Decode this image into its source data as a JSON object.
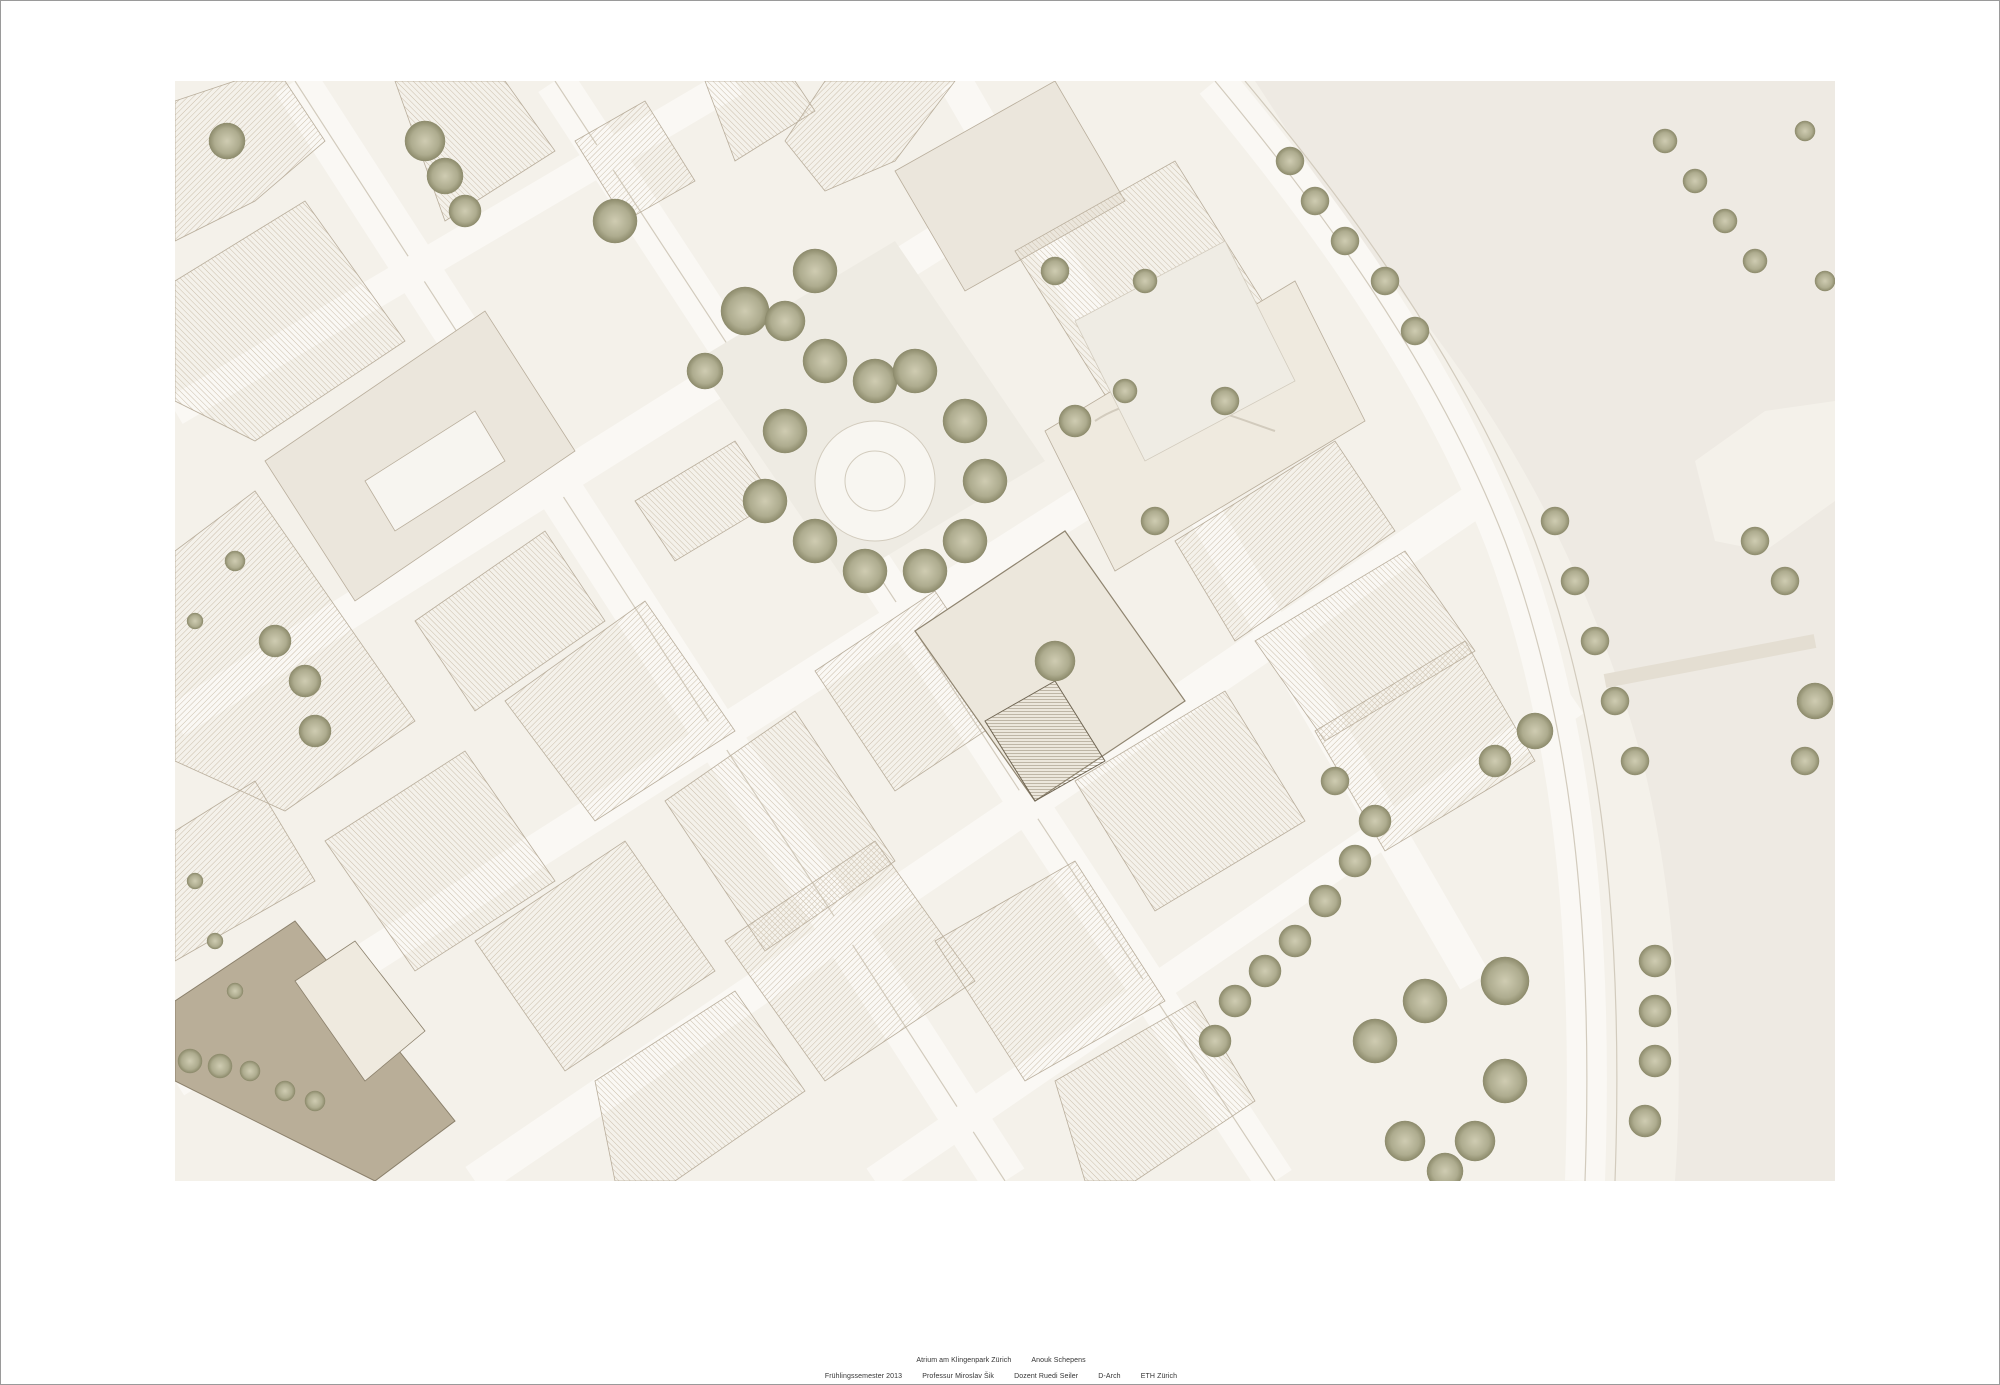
{
  "footer": {
    "line1": [
      "Atrium am Klingenpark Zürich",
      "Anouk Schepens"
    ],
    "line2": [
      "Frühlingssemester 2013",
      "Professur Miroslav Šik",
      "Dozent Ruedi Seiler",
      "D-Arch",
      "ETH Zürich"
    ]
  },
  "colors": {
    "paper": "#fbfaf7",
    "ground": "#f4f1ea",
    "building": "#e7e1d5",
    "building_stroke": "#b9ae9c",
    "hatch": "#cfc5b3",
    "water": "#eeeae3",
    "tree": "#b9b79a",
    "tree_dark": "#8f8d6e",
    "road": "#faf8f4",
    "road_edge": "#d2cbbd"
  }
}
